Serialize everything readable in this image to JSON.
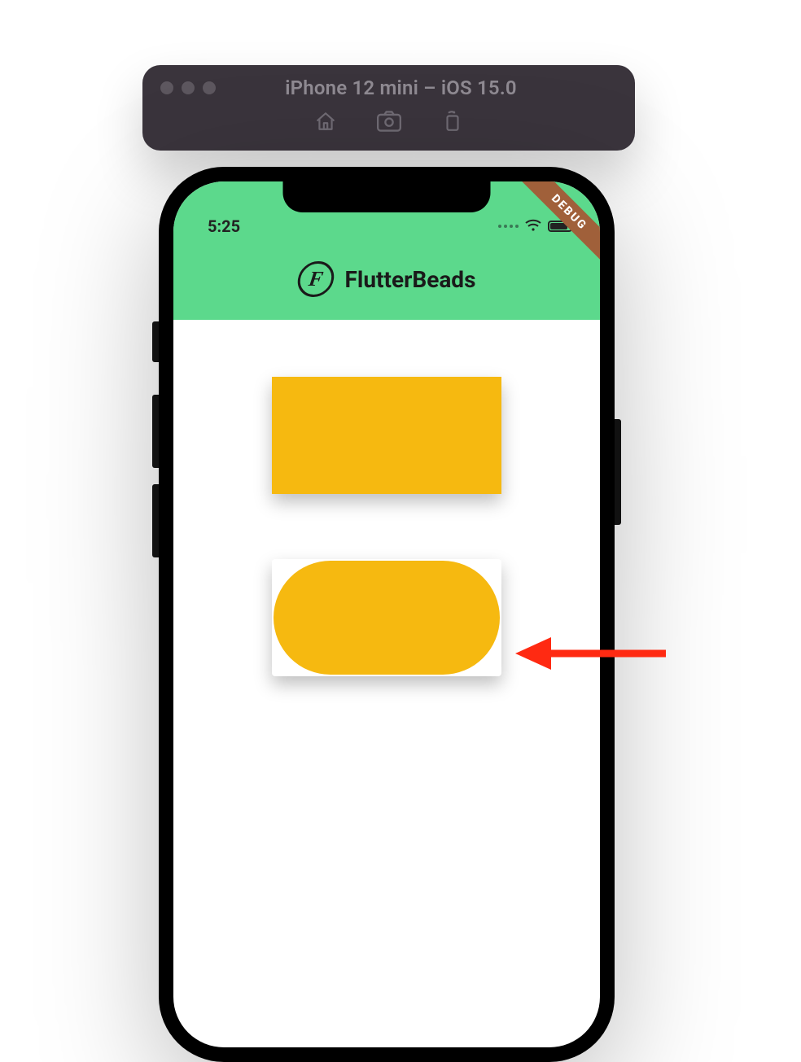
{
  "simulator": {
    "title": "iPhone 12 mini – iOS 15.0",
    "actions": {
      "home": "home-icon",
      "screenshot": "screenshot-icon",
      "rotate": "rotate-icon"
    }
  },
  "status": {
    "time": "5:25"
  },
  "app": {
    "logo_letter": "F",
    "title": "FlutterBeads",
    "debug_banner": "DEBUG"
  },
  "cards": {
    "card1_color": "#f6b910",
    "card2_color": "#f6b910"
  },
  "annotation": {
    "arrow_color": "#ff2a12"
  }
}
